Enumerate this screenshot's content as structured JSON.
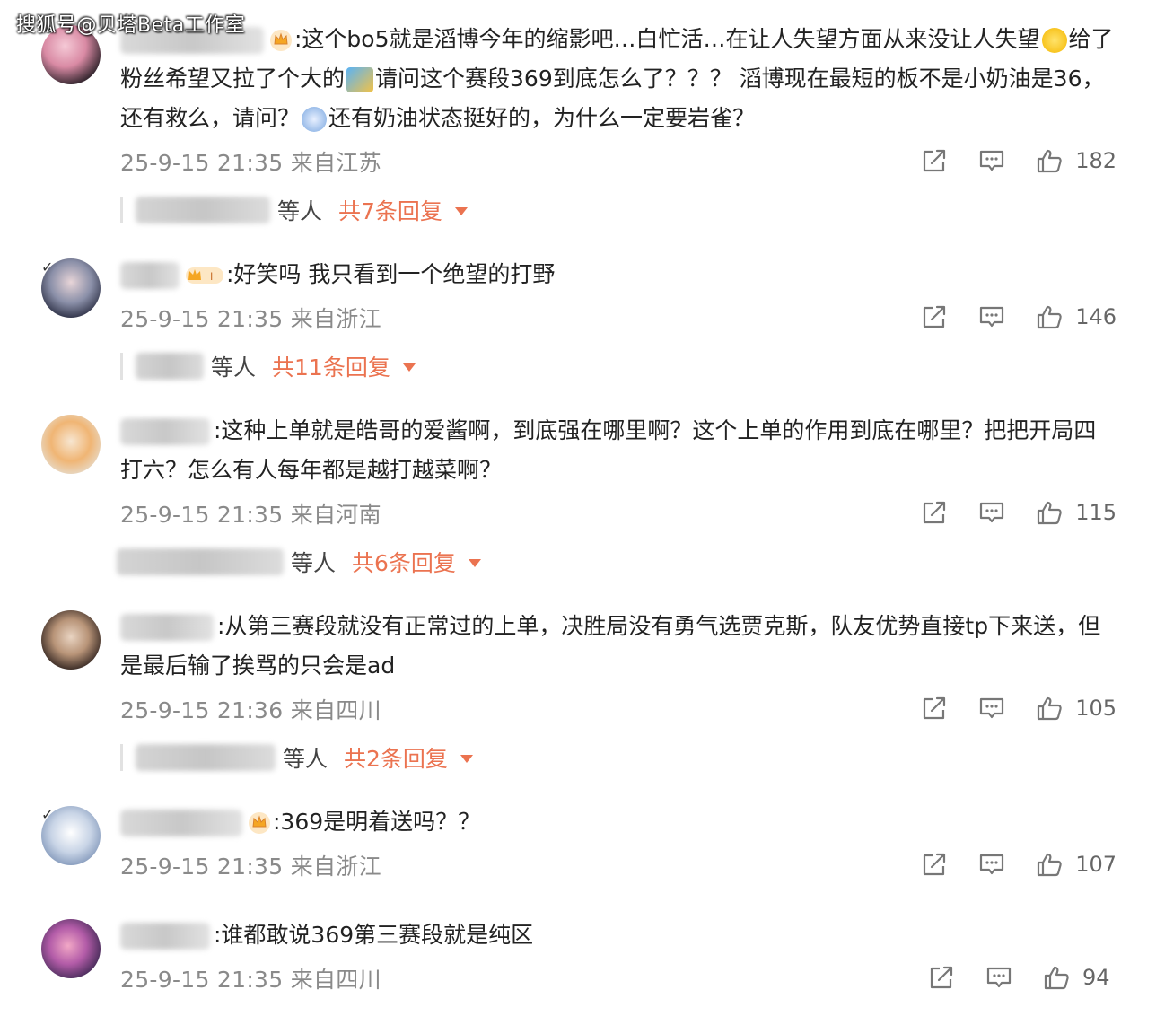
{
  "watermark": "搜狐号@贝塔Beta工作室",
  "comments": [
    {
      "text": ":这个bo5就是滔博今年的缩影吧…白忙活…在让人失望方面从来没让人失望",
      "text_after_emoji": "给了粉丝希望又拉了个大的",
      "text_after_emoji2": "请问这个赛段369到底怎么了？？？ 滔博现在最短的板不是小奶油是36，还有救么，请问？",
      "text_after_emoji3": "还有奶油状态挺好的，为什么一定要岩雀？",
      "meta": "25-9-15 21:35 来自江苏",
      "likes": "182",
      "reply_suffix": "等人",
      "reply_link": "共7条回复"
    },
    {
      "text": ":好笑吗 我只看到一个绝望的打野",
      "meta": "25-9-15 21:35 来自浙江",
      "likes": "146",
      "reply_suffix": "等人",
      "reply_link": "共11条回复"
    },
    {
      "text": ":这种上单就是皓哥的爱酱啊，到底强在哪里啊？这个上单的作用到底在哪里？把把开局四打六？怎么有人每年都是越打越菜啊？",
      "meta": "25-9-15 21:35 来自河南",
      "likes": "115",
      "reply_suffix": "等人",
      "reply_link": "共6条回复"
    },
    {
      "text": ":从第三赛段就没有正常过的上单，决胜局没有勇气选贾克斯，队友优势直接tp下来送，但是最后输了挨骂的只会是ad",
      "meta": "25-9-15 21:36 来自四川",
      "likes": "105",
      "reply_suffix": "等人",
      "reply_link": "共2条回复"
    },
    {
      "text": ":369是明着送吗？？",
      "meta": "25-9-15 21:35 来自浙江",
      "likes": "107"
    },
    {
      "text": ":谁都敢说369第三赛段就是纯区",
      "meta": "25-9-15 21:35 来自四川",
      "likes": "94"
    }
  ],
  "colors": {
    "reply_link": "#eb7350",
    "meta": "#8a8a8a",
    "text": "#222222"
  },
  "icons": [
    "share-icon",
    "comment-icon",
    "like-icon",
    "chevron-down-icon",
    "crown-badge-icon",
    "verified-badge-icon"
  ]
}
